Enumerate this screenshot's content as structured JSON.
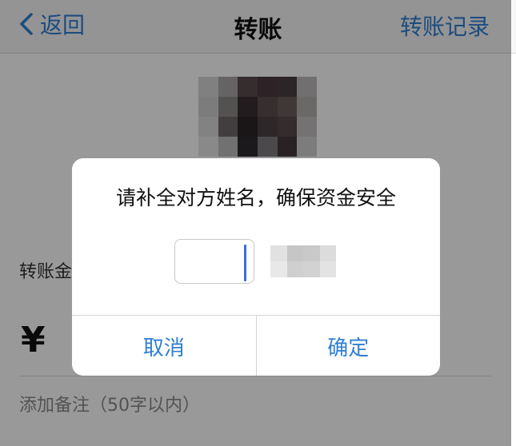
{
  "nav": {
    "back_label": "返回",
    "title": "转账",
    "history_label": "转账记录"
  },
  "form": {
    "amount_label": "转账金额",
    "currency_symbol": "¥",
    "remark_placeholder": "添加备注（50字以内）"
  },
  "dialog": {
    "message": "请补全对方姓名，确保资金安全",
    "name_input_value": "",
    "cancel_label": "取消",
    "confirm_label": "确定"
  },
  "colors": {
    "accent": "#2f7fd3",
    "cursor": "#3a6fd6",
    "overlay": "rgba(0,0,0,0.40)"
  },
  "icons": {
    "back": "chevron-left-icon"
  }
}
